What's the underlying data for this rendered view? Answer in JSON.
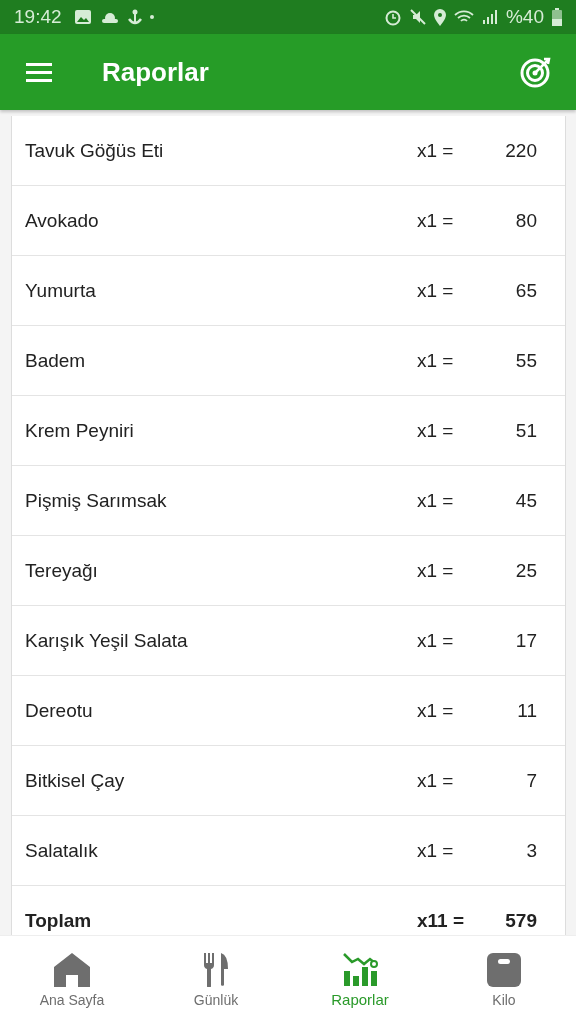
{
  "status_bar": {
    "time": "19:42",
    "battery": "%40"
  },
  "app_bar": {
    "title": "Raporlar"
  },
  "rows": [
    {
      "name": "Tavuk Göğüs Eti",
      "qty": "x1 =",
      "value": "220"
    },
    {
      "name": "Avokado",
      "qty": "x1 =",
      "value": "80"
    },
    {
      "name": "Yumurta",
      "qty": "x1 =",
      "value": "65"
    },
    {
      "name": "Badem",
      "qty": "x1 =",
      "value": "55"
    },
    {
      "name": "Krem Peyniri",
      "qty": "x1 =",
      "value": "51"
    },
    {
      "name": "Pişmiş Sarımsak",
      "qty": "x1 =",
      "value": "45"
    },
    {
      "name": "Tereyağı",
      "qty": "x1 =",
      "value": "25"
    },
    {
      "name": "Karışık Yeşil Salata",
      "qty": "x1 =",
      "value": "17"
    },
    {
      "name": "Dereotu",
      "qty": "x1 =",
      "value": "11"
    },
    {
      "name": "Bitkisel Çay",
      "qty": "x1 =",
      "value": "7"
    },
    {
      "name": "Salatalık",
      "qty": "x1 =",
      "value": "3"
    }
  ],
  "total": {
    "name": "Toplam",
    "qty": "x11 =",
    "value": "579"
  },
  "bottom_nav": [
    {
      "label": "Ana Sayfa",
      "kind": "home",
      "selected": false
    },
    {
      "label": "Günlük",
      "kind": "diary",
      "selected": false
    },
    {
      "label": "Raporlar",
      "kind": "reports",
      "selected": true
    },
    {
      "label": "Kilo",
      "kind": "scale",
      "selected": false
    }
  ]
}
